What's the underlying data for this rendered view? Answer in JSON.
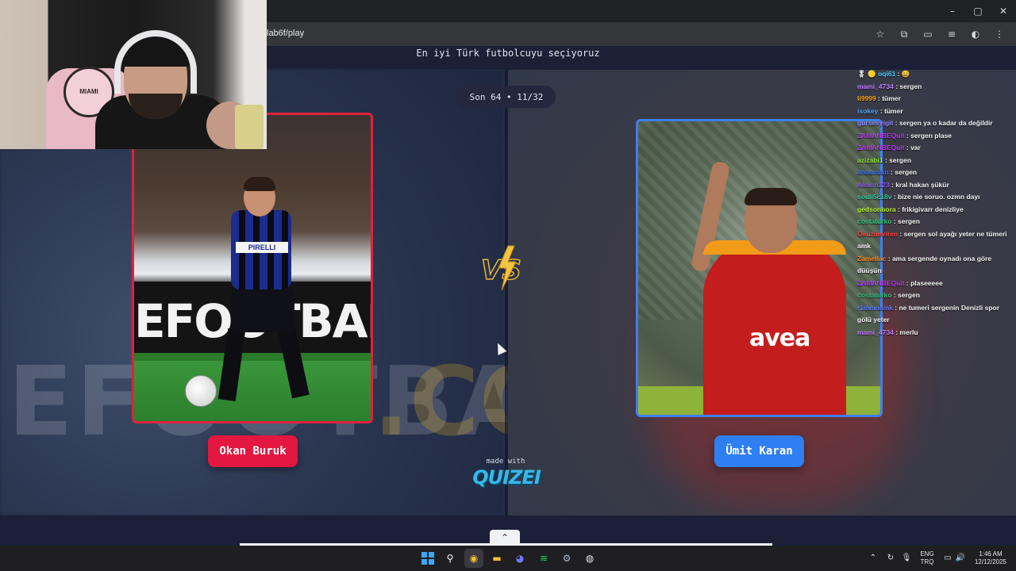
{
  "browser": {
    "url": "lab6f/play",
    "window_controls": [
      "–",
      "▢",
      "✕"
    ],
    "toolbar_icons": [
      "star-icon",
      "extensions-icon",
      "cast-icon",
      "media-icon",
      "profile-icon",
      "menu-icon"
    ]
  },
  "page": {
    "heading": "En iyi Türk futbolcuyu seçiyoruz",
    "round": "Son 64 • 11/32",
    "left_player": {
      "name": "Okan Buruk",
      "jersey_sponsor": "PIRELLI",
      "ad_board": "EFOOTBALL",
      "ad_board_accent": ".CO",
      "border_color": "#e0213f"
    },
    "right_player": {
      "name": "Ümit Karan",
      "jersey_sponsor": "avea",
      "border_color": "#3e7ff0"
    },
    "vs_label": "VS",
    "made_with": "made with",
    "brand": "QUIZEI",
    "scroll_up_glyph": "⌃"
  },
  "webcam": {
    "crest_text": "CLUB INTERNACIONAL MIAMI"
  },
  "chat": [
    {
      "user": "oqi61",
      "msg": "😄",
      "color": "#3fd0ff",
      "prefix": "🎖 🟡 "
    },
    {
      "user": "mami_4734",
      "msg": "sergen",
      "color": "#c27cff"
    },
    {
      "user": "li9999",
      "msg": "tümer",
      "color": "#ff9f1a"
    },
    {
      "user": "isokey",
      "msg": "tümer",
      "color": "#4aa7ff"
    },
    {
      "user": "gursesyigit",
      "msg": "sergen ya o kadar da değildir",
      "color": "#8f88ff"
    },
    {
      "user": "ZAMANBEQuit",
      "msg": "sergen plase",
      "color": "#b33cf0"
    },
    {
      "user": "ZAMANBEQuit",
      "msg": "var",
      "color": "#b33cf0"
    },
    {
      "user": "azizabi1",
      "msg": "sergen",
      "color": "#8fe33a"
    },
    {
      "user": "khosmain",
      "msg": "sergen",
      "color": "#3d6ef0"
    },
    {
      "user": "Almon123",
      "msg": "kral hakan şükür",
      "color": "#8a5cf0"
    },
    {
      "user": "souli5c18v",
      "msg": "bize nie soruo. ozmn dayı",
      "color": "#38c9a0"
    },
    {
      "user": "gedsonbora",
      "msg": "frikigivarr denizliye",
      "color": "#b9f03a"
    },
    {
      "user": "costaturko",
      "msg": "sergen",
      "color": "#2ec27e"
    },
    {
      "user": "Okuzdeviren",
      "msg": "sergen sol ayağı yeter ne tümeri amk",
      "color": "#ff3b3b"
    },
    {
      "user": "Zamellac",
      "msg": "ama sergende oynadı ona göre düüşün",
      "color": "#ff8a1a"
    },
    {
      "user": "ZAMANBEQuit",
      "msg": "plaseeeee",
      "color": "#b33cf0"
    },
    {
      "user": "costaturko",
      "msg": "sergen",
      "color": "#2ec27e"
    },
    {
      "user": "r1dvanamk",
      "msg": "ne tumeri sergenin Denizli spor gölü yeter",
      "color": "#5b7cff"
    },
    {
      "user": "mami_4734",
      "msg": "merlu",
      "color": "#c27cff"
    }
  ],
  "taskbar": {
    "apps": [
      {
        "name": "start-icon",
        "glyph": ""
      },
      {
        "name": "search-icon",
        "glyph": "⚲"
      },
      {
        "name": "chrome-icon",
        "glyph": "◉"
      },
      {
        "name": "file-explorer-icon",
        "glyph": "▬"
      },
      {
        "name": "discord-icon",
        "glyph": "◕"
      },
      {
        "name": "spotify-icon",
        "glyph": "≋"
      },
      {
        "name": "settings-icon",
        "glyph": "⚙"
      },
      {
        "name": "recorder-icon",
        "glyph": "◍"
      }
    ],
    "tray": {
      "chevron": "⌃",
      "lang_line1": "ENG",
      "lang_line2": "TRQ",
      "time": "1:46 AM",
      "date": "12/12/2025"
    }
  }
}
